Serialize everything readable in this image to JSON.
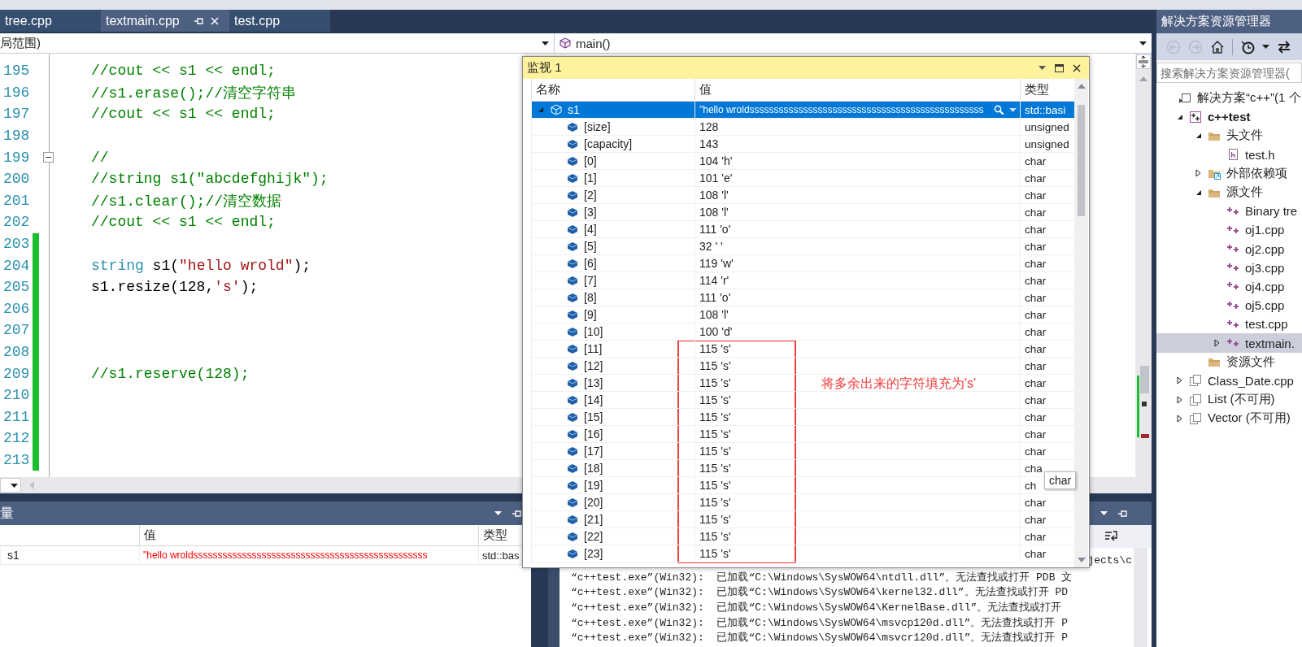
{
  "tabs": [
    {
      "label": "tree.cpp",
      "selected": false,
      "pinned": false
    },
    {
      "label": "textmain.cpp",
      "selected": true,
      "pinned": true
    },
    {
      "label": "test.cpp",
      "selected": false,
      "pinned": false
    }
  ],
  "nav_bar": {
    "scope": "局范围)",
    "member": "main()"
  },
  "editor": {
    "lines": [
      {
        "number": "195",
        "changed": false,
        "foldable": false,
        "tokens": [
          {
            "kind": "comment",
            "text": "//cout << s1 << endl;"
          }
        ]
      },
      {
        "number": "196",
        "changed": false,
        "foldable": false,
        "tokens": [
          {
            "kind": "comment",
            "text": "//s1.erase();//清空字符串"
          }
        ]
      },
      {
        "number": "197",
        "changed": false,
        "foldable": false,
        "tokens": [
          {
            "kind": "comment",
            "text": "//cout << s1 << endl;"
          }
        ]
      },
      {
        "number": "198",
        "changed": false,
        "foldable": false
      },
      {
        "number": "199",
        "changed": false,
        "foldable": true,
        "tokens": [
          {
            "kind": "comment",
            "text": "//"
          }
        ]
      },
      {
        "number": "200",
        "changed": false,
        "foldable": false,
        "tokens": [
          {
            "kind": "comment",
            "text": "//string s1(\"abcdefghijk\");"
          }
        ]
      },
      {
        "number": "201",
        "changed": false,
        "foldable": false,
        "tokens": [
          {
            "kind": "comment",
            "text": "//s1.clear();//清空数据"
          }
        ]
      },
      {
        "number": "202",
        "changed": false,
        "foldable": false,
        "tokens": [
          {
            "kind": "comment",
            "text": "//cout << s1 << endl;"
          }
        ]
      },
      {
        "number": "203",
        "changed": true,
        "foldable": false
      },
      {
        "number": "204",
        "changed": true,
        "foldable": false,
        "tokens": [
          {
            "kind": "keyword",
            "text": "string"
          },
          {
            "kind": "plain",
            "text": " s1("
          },
          {
            "kind": "string",
            "text": "\"hello wrold\""
          },
          {
            "kind": "plain",
            "text": ");"
          }
        ]
      },
      {
        "number": "205",
        "changed": true,
        "foldable": false,
        "tokens": [
          {
            "kind": "plain",
            "text": "s1.resize(128,"
          },
          {
            "kind": "string",
            "text": "'s'"
          },
          {
            "kind": "plain",
            "text": ");"
          }
        ]
      },
      {
        "number": "206",
        "changed": true,
        "foldable": false
      },
      {
        "number": "207",
        "changed": true,
        "foldable": false
      },
      {
        "number": "208",
        "changed": true,
        "foldable": false
      },
      {
        "number": "209",
        "changed": true,
        "foldable": false,
        "tokens": [
          {
            "kind": "comment",
            "text": "//s1.reserve(128);"
          }
        ]
      },
      {
        "number": "210",
        "changed": true,
        "foldable": false
      },
      {
        "number": "211",
        "changed": true,
        "foldable": false
      },
      {
        "number": "212",
        "changed": true,
        "foldable": false
      },
      {
        "number": "213",
        "changed": true,
        "foldable": false
      }
    ]
  },
  "watch_window": {
    "title": "监视 1",
    "columns": [
      "名称",
      "值",
      "类型"
    ],
    "rows": [
      {
        "name": "s1",
        "value": "\"hello wroldssssssssssssssssssssssssssssssssssssssssssssssss",
        "type": "std::basi",
        "selected": true,
        "expanded": true,
        "children": [
          {
            "name": "[size]",
            "value": "128",
            "type": "unsigned",
            "selected": false
          },
          {
            "name": "[capacity]",
            "value": "143",
            "type": "unsigned",
            "selected": false
          },
          {
            "name": "[0]",
            "value": "104 'h'",
            "type": "char",
            "selected": false
          },
          {
            "name": "[1]",
            "value": "101 'e'",
            "type": "char",
            "selected": false
          },
          {
            "name": "[2]",
            "value": "108 'l'",
            "type": "char",
            "selected": false
          },
          {
            "name": "[3]",
            "value": "108 'l'",
            "type": "char",
            "selected": false
          },
          {
            "name": "[4]",
            "value": "111 'o'",
            "type": "char",
            "selected": false
          },
          {
            "name": "[5]",
            "value": "32 ' '",
            "type": "char",
            "selected": false
          },
          {
            "name": "[6]",
            "value": "119 'w'",
            "type": "char",
            "selected": false
          },
          {
            "name": "[7]",
            "value": "114 'r'",
            "type": "char",
            "selected": false
          },
          {
            "name": "[8]",
            "value": "111 'o'",
            "type": "char",
            "selected": false
          },
          {
            "name": "[9]",
            "value": "108 'l'",
            "type": "char",
            "selected": false
          },
          {
            "name": "[10]",
            "value": "100 'd'",
            "type": "char",
            "selected": false
          },
          {
            "name": "[11]",
            "value": "115 's'",
            "type": "char",
            "selected": false
          },
          {
            "name": "[12]",
            "value": "115 's'",
            "type": "char",
            "selected": false
          },
          {
            "name": "[13]",
            "value": "115 's'",
            "type": "char",
            "selected": false
          },
          {
            "name": "[14]",
            "value": "115 's'",
            "type": "char",
            "selected": false
          },
          {
            "name": "[15]",
            "value": "115 's'",
            "type": "char",
            "selected": false
          },
          {
            "name": "[16]",
            "value": "115 's'",
            "type": "char",
            "selected": false
          },
          {
            "name": "[17]",
            "value": "115 's'",
            "type": "char",
            "selected": false
          },
          {
            "name": "[18]",
            "value": "115 's'",
            "type": "cha",
            "selected": false
          },
          {
            "name": "[19]",
            "value": "115 's'",
            "type": "ch",
            "selected": false
          },
          {
            "name": "[20]",
            "value": "115 's'",
            "type": "char",
            "selected": false
          },
          {
            "name": "[21]",
            "value": "115 's'",
            "type": "char",
            "selected": false
          },
          {
            "name": "[22]",
            "value": "115 's'",
            "type": "char",
            "selected": false
          },
          {
            "name": "[23]",
            "value": "115 's'",
            "type": "char",
            "selected": false
          }
        ]
      }
    ],
    "tooltip": "char",
    "annotation": "将多余出来的字符填充为's'"
  },
  "locals_panel": {
    "title": "量",
    "columns": [
      "值",
      "类型"
    ],
    "rows": [
      {
        "name": "s1",
        "value": "\"hello wroldssssssssssssssssssssssssssssssssssssssssssssssss",
        "type": "std::bas",
        "changed": true
      }
    ]
  },
  "output_panel": {
    "lines": [
      {
        "text": "jects\\c",
        "covered": true
      },
      {
        "text": "“c++test.exe”(Win32):  已加载“C:\\Windows\\SysWOW64\\ntdll.dll”。无法查找或打开 PDB 文",
        "covered": false
      },
      {
        "text": "“c++test.exe”(Win32):  已加载“C:\\Windows\\SysWOW64\\kernel32.dll”。无法查找或打开 PD",
        "covered": false
      },
      {
        "text": "“c++test.exe”(Win32):  已加载“C:\\Windows\\SysWOW64\\KernelBase.dll”。无法查找或打开",
        "covered": false
      },
      {
        "text": "“c++test.exe”(Win32):  已加载“C:\\Windows\\SysWOW64\\msvcp120d.dll”。无法查找或打开 P",
        "covered": false
      },
      {
        "text": "“c++test.exe”(Win32):  已加载“C:\\Windows\\SysWOW64\\msvcr120d.dll”。无法查找或打开 P",
        "covered": false
      }
    ]
  },
  "solution_explorer": {
    "title": "解决方案资源管理器",
    "search": {
      "placeholder": "搜索解决方案资源管理器("
    },
    "tree": [
      {
        "label": "解决方案“c++”(1 个",
        "kind": "solution",
        "selected": false,
        "children": [
          {
            "label": "c++test",
            "kind": "project",
            "startup": true,
            "expanded": true,
            "selected": false,
            "children": [
              {
                "label": "头文件",
                "kind": "folder",
                "expanded": true,
                "selected": false,
                "children": [
                  {
                    "label": "test.h",
                    "kind": "header",
                    "selected": false
                  }
                ]
              },
              {
                "label": "外部依赖项",
                "kind": "external",
                "expanded": false,
                "selected": false
              },
              {
                "label": "源文件",
                "kind": "folder",
                "expanded": true,
                "selected": false,
                "children": [
                  {
                    "label": "Binary tre",
                    "kind": "cpp",
                    "selected": false
                  },
                  {
                    "label": "oj1.cpp",
                    "kind": "cpp",
                    "selected": false
                  },
                  {
                    "label": "oj2.cpp",
                    "kind": "cpp",
                    "selected": false
                  },
                  {
                    "label": "oj3.cpp",
                    "kind": "cpp",
                    "selected": false
                  },
                  {
                    "label": "oj4.cpp",
                    "kind": "cpp",
                    "selected": false
                  },
                  {
                    "label": "oj5.cpp",
                    "kind": "cpp",
                    "selected": false
                  },
                  {
                    "label": "test.cpp",
                    "kind": "cpp",
                    "selected": false
                  },
                  {
                    "label": "textmain.",
                    "kind": "cpp",
                    "expanded": false,
                    "selected": true
                  }
                ]
              },
              {
                "label": "资源文件",
                "kind": "folder",
                "selected": false
              }
            ]
          },
          {
            "label": "Class_Date.cpp",
            "kind": "other",
            "expanded": false,
            "selected": false
          },
          {
            "label": "List (不可用)",
            "kind": "other",
            "expanded": false,
            "selected": false
          },
          {
            "label": "Vector (不可用)",
            "kind": "other",
            "expanded": false,
            "selected": false
          }
        ]
      }
    ]
  }
}
